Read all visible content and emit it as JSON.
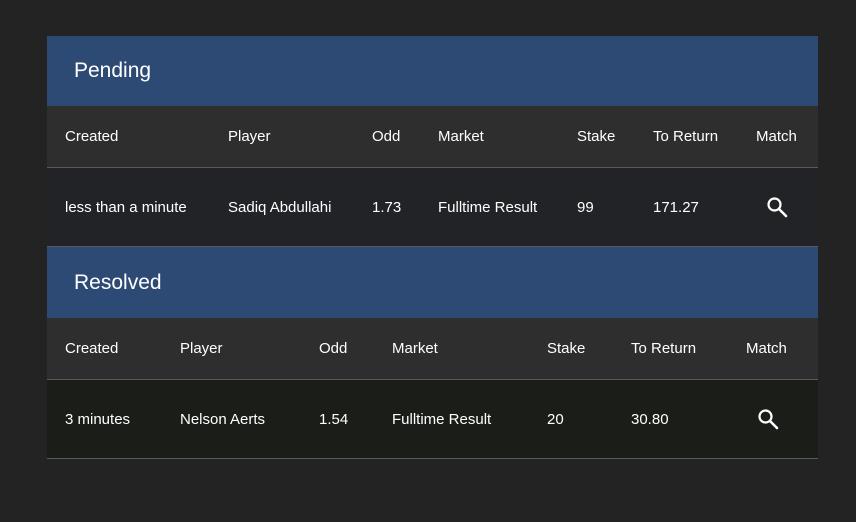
{
  "pending": {
    "title": "Pending",
    "columns": [
      "Created",
      "Player",
      "Odd",
      "Market",
      "Stake",
      "To Return",
      "Match"
    ],
    "rows": [
      {
        "created": "less than a minute",
        "player": "Sadiq Abdullahi",
        "odd": "1.73",
        "market": "Fulltime Result",
        "stake": "99",
        "to_return": "171.27",
        "match_icon": "search-icon"
      }
    ]
  },
  "resolved": {
    "title": "Resolved",
    "columns": [
      "Created",
      "Player",
      "Odd",
      "Market",
      "Stake",
      "To Return",
      "Match"
    ],
    "rows": [
      {
        "created": "3 minutes",
        "player": "Nelson Aerts",
        "odd": "1.54",
        "market": "Fulltime Result",
        "stake": "20",
        "to_return": "30.80",
        "match_icon": "search-icon"
      }
    ]
  },
  "colors": {
    "page_background": "#232323",
    "section_header": "#2d4a74",
    "table_header": "#2e2e2e",
    "pending_row": "#222326",
    "resolved_row": "#1b1d18"
  }
}
